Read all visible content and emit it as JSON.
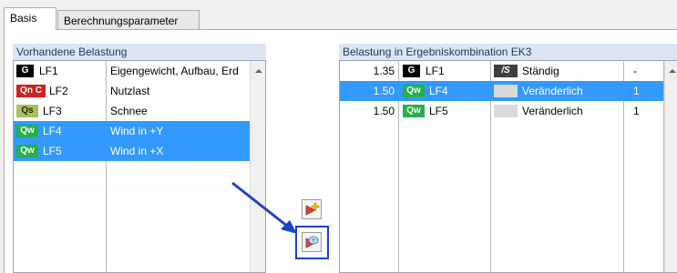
{
  "tabs": [
    {
      "label": "Basis"
    },
    {
      "label": "Berechnungsparameter"
    }
  ],
  "left_panel": {
    "header": "Vorhandene Belastung",
    "rows": [
      {
        "badge": "G",
        "badge_color": "#000000",
        "case": "LF1",
        "description": "Eigengewicht, Aufbau, Erd",
        "selected": false
      },
      {
        "badge": "Qn C",
        "badge_color": "#cc2222",
        "case": "LF2",
        "description": "Nutzlast",
        "selected": false
      },
      {
        "badge": "Qs",
        "badge_color": "#a8c060",
        "case": "LF3",
        "description": "Schnee",
        "selected": false
      },
      {
        "badge": "Qw",
        "badge_color": "#22b14c",
        "case": "LF4",
        "description": "Wind in +Y",
        "selected": true
      },
      {
        "badge": "Qw",
        "badge_color": "#22b14c",
        "case": "LF5",
        "description": "Wind in +X",
        "selected": true
      }
    ]
  },
  "right_panel": {
    "header": "Belastung in Ergebniskombination EK3",
    "rows": [
      {
        "factor": "1.35",
        "badge": "G",
        "badge_color": "#000000",
        "case": "LF1",
        "duration_icon": "/S",
        "duration": "Ständig",
        "group": "-",
        "selected": false
      },
      {
        "factor": "1.50",
        "badge": "Qw",
        "badge_color": "#22b14c",
        "case": "LF4",
        "duration_icon": "",
        "duration": "Veränderlich",
        "group": "1",
        "selected": true
      },
      {
        "factor": "1.50",
        "badge": "Qw",
        "badge_color": "#22b14c",
        "case": "LF5",
        "duration_icon": "",
        "duration": "Veränderlich",
        "group": "1",
        "selected": false
      }
    ]
  },
  "buttons": {
    "add_icon": "add-load-case-icon",
    "add_with_factor_icon": "add-with-factor-icon"
  },
  "colors": {
    "selection": "#3399ff",
    "header_bg": "#dce6f2",
    "highlight_border": "#1a44c8",
    "arrow": "#1a44c8"
  }
}
